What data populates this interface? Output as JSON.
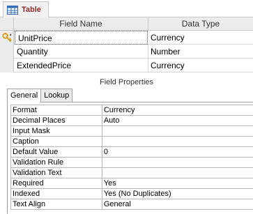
{
  "tab": {
    "label": "Table"
  },
  "grid": {
    "columns": {
      "field_name": "Field Name",
      "data_type": "Data Type"
    },
    "rows": [
      {
        "name": "UnitPrice",
        "type": "Currency",
        "primary_key": true
      },
      {
        "name": "Quantity",
        "type": "Number",
        "primary_key": false
      },
      {
        "name": "ExtendedPrice",
        "type": "Currency",
        "primary_key": false
      }
    ]
  },
  "field_properties": {
    "title": "Field Properties",
    "tabs": [
      "General",
      "Lookup"
    ],
    "properties": [
      {
        "name": "Format",
        "value": "Currency"
      },
      {
        "name": "Decimal Places",
        "value": "Auto"
      },
      {
        "name": "Input Mask",
        "value": ""
      },
      {
        "name": "Caption",
        "value": ""
      },
      {
        "name": "Default Value",
        "value": "0"
      },
      {
        "name": "Validation Rule",
        "value": ""
      },
      {
        "name": "Validation Text",
        "value": ""
      },
      {
        "name": "Required",
        "value": "Yes"
      },
      {
        "name": "Indexed",
        "value": "Yes (No Duplicates)"
      },
      {
        "name": "Text Align",
        "value": "General"
      }
    ]
  },
  "colors": {
    "tab_label": "#8b2a2a",
    "key_icon": "#d4a017"
  },
  "icons": {
    "tab": "table-icon",
    "row_selector": "primary-key-icon"
  }
}
